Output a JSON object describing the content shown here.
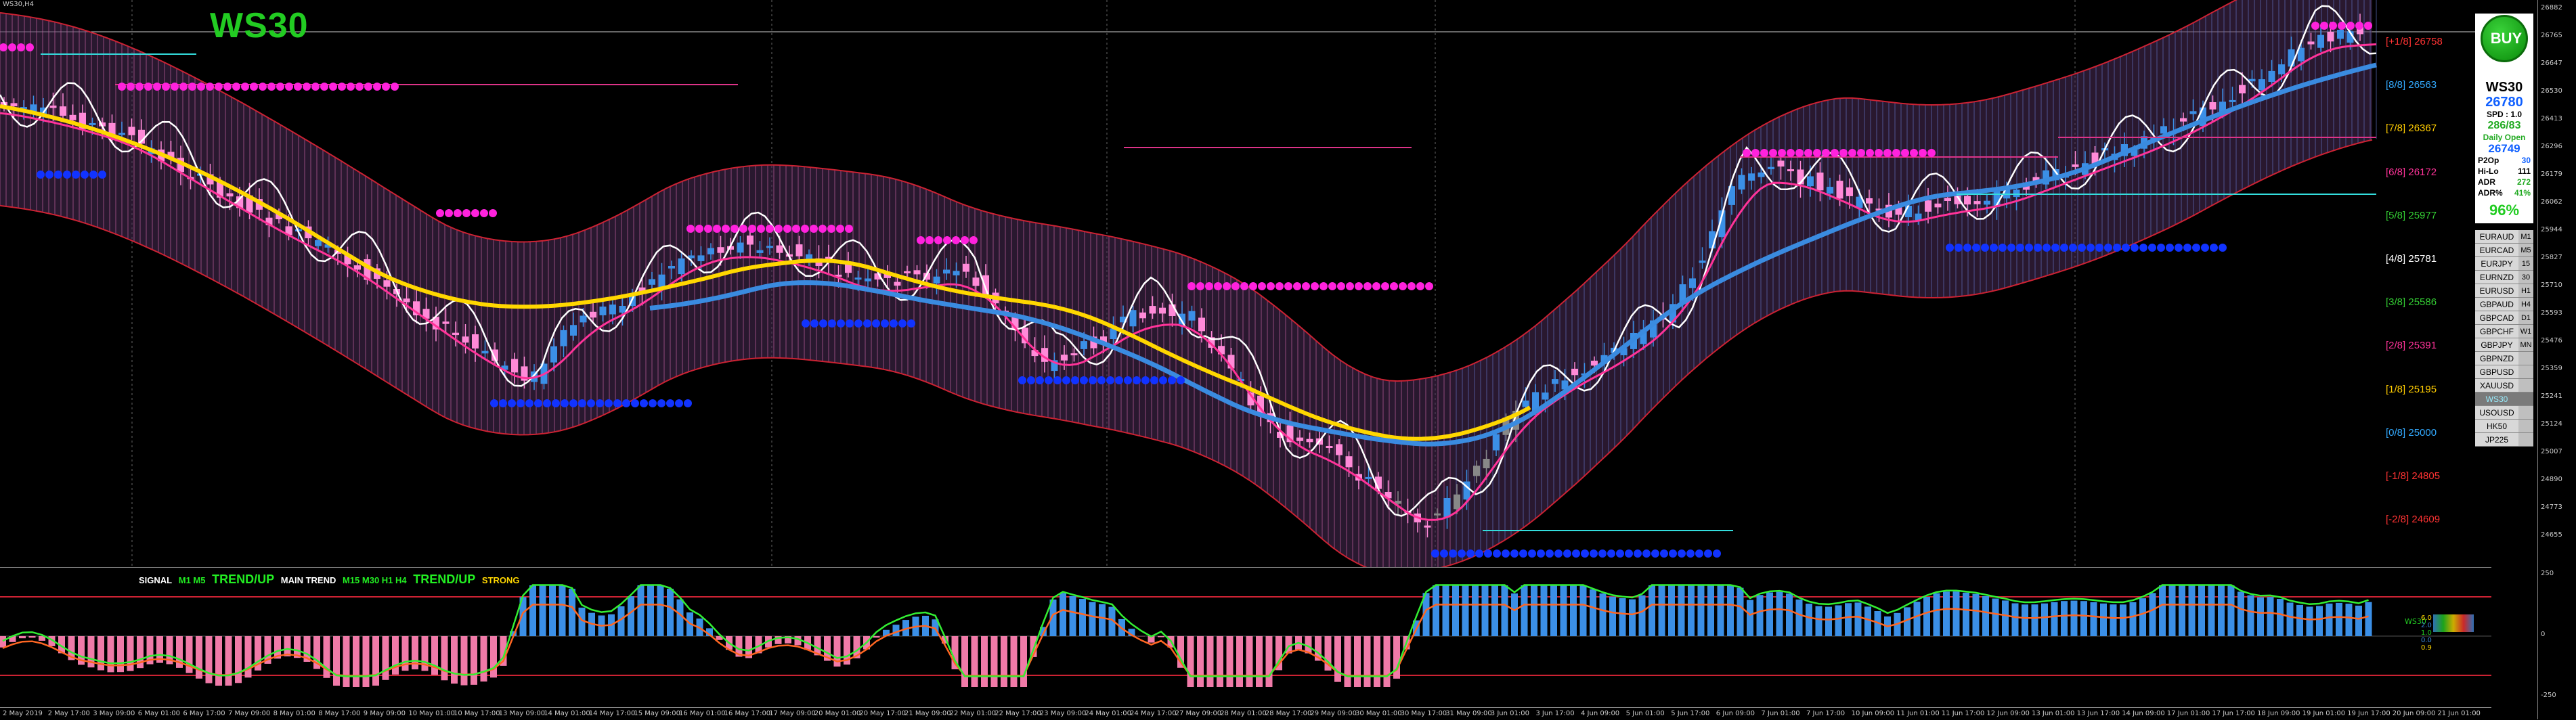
{
  "window": {
    "title": "WS30,H4"
  },
  "symbol": {
    "title": "WS30"
  },
  "murrey_levels": [
    {
      "label": "[+1/8] 26758",
      "color": "#ff3333"
    },
    {
      "label": "[8/8] 26563",
      "color": "#33aaff"
    },
    {
      "label": "[7/8] 26367",
      "color": "#ffcc00"
    },
    {
      "label": "[6/8] 26172",
      "color": "#ff3399"
    },
    {
      "label": "[5/8] 25977",
      "color": "#33cc33"
    },
    {
      "label": "[4/8] 25781",
      "color": "#ffffff"
    },
    {
      "label": "[3/8] 25586",
      "color": "#33cc33"
    },
    {
      "label": "[2/8] 25391",
      "color": "#ff3399"
    },
    {
      "label": "[1/8] 25195",
      "color": "#ffcc00"
    },
    {
      "label": "[0/8] 25000",
      "color": "#33aaff"
    },
    {
      "label": "[-1/8] 24805",
      "color": "#ff3333"
    },
    {
      "label": "[-2/8] 24609",
      "color": "#ff3333"
    }
  ],
  "signal_panel": {
    "buy_label": "BUY",
    "symbol": "WS30",
    "price": "26780",
    "spread": "SPD : 1.0",
    "range": "286/83",
    "daily_open_label": "Daily Open",
    "daily_open": "26749",
    "rows": [
      {
        "k": "P2Op",
        "v": "30"
      },
      {
        "k": "Hi-Lo",
        "v": "111"
      },
      {
        "k": "ADR",
        "v": "272"
      },
      {
        "k": "ADR%",
        "v": "41%"
      }
    ],
    "strength": "96%"
  },
  "pairs": [
    {
      "name": "EURAUD",
      "tf": "M1"
    },
    {
      "name": "EURCAD",
      "tf": "M5"
    },
    {
      "name": "EURJPY",
      "tf": "15"
    },
    {
      "name": "EURNZD",
      "tf": "30"
    },
    {
      "name": "EURUSD",
      "tf": "H1"
    },
    {
      "name": "GBPAUD",
      "tf": "H4"
    },
    {
      "name": "GBPCAD",
      "tf": "D1"
    },
    {
      "name": "GBPCHF",
      "tf": "W1"
    },
    {
      "name": "GBPJPY",
      "tf": "MN"
    },
    {
      "name": "GBPNZD",
      "tf": ""
    },
    {
      "name": "GBPUSD",
      "tf": ""
    },
    {
      "name": "XAUUSD",
      "tf": ""
    },
    {
      "name": "WS30",
      "tf": ""
    },
    {
      "name": "USOUSD",
      "tf": ""
    },
    {
      "name": "HK50",
      "tf": ""
    },
    {
      "name": "JP225",
      "tf": ""
    }
  ],
  "osc_header": {
    "signal": "SIGNAL",
    "signal_tf": "M1 M5",
    "signal_trend": "TREND/UP",
    "main_trend": "MAIN TREND",
    "main_tf": "M15 M30 H1 H4",
    "main_trend_val": "TREND/UP",
    "strength": "STRONG"
  },
  "osc_legend": {
    "label": "WS30",
    "levels": [
      "6.0",
      "2.0",
      "1.0",
      "0.0",
      "0.9"
    ]
  },
  "time_labels": [
    "2 May 2019",
    "2 May 17:00",
    "3 May 09:00",
    "6 May 01:00",
    "6 May 17:00",
    "7 May 09:00",
    "8 May 01:00",
    "8 May 17:00",
    "9 May 09:00",
    "10 May 01:00",
    "10 May 17:00",
    "13 May 09:00",
    "14 May 01:00",
    "14 May 17:00",
    "15 May 09:00",
    "16 May 01:00",
    "16 May 17:00",
    "17 May 09:00",
    "20 May 01:00",
    "20 May 17:00",
    "21 May 09:00",
    "22 May 01:00",
    "22 May 17:00",
    "23 May 09:00",
    "24 May 01:00",
    "24 May 17:00",
    "27 May 09:00",
    "28 May 01:00",
    "28 May 17:00",
    "29 May 09:00",
    "30 May 01:00",
    "30 May 17:00",
    "31 May 09:00",
    "3 Jun 01:00",
    "3 Jun 17:00",
    "4 Jun 09:00",
    "5 Jun 01:00",
    "5 Jun 17:00",
    "6 Jun 09:00",
    "7 Jun 01:00",
    "7 Jun 17:00",
    "10 Jun 09:00",
    "11 Jun 01:00",
    "11 Jun 17:00",
    "12 Jun 09:00",
    "13 Jun 01:00",
    "13 Jun 17:00",
    "14 Jun 09:00",
    "17 Jun 01:00",
    "17 Jun 17:00",
    "18 Jun 09:00",
    "19 Jun 01:00",
    "19 Jun 17:00",
    "20 Jun 09:00",
    "21 Jun 01:00"
  ],
  "price_scale": [
    "26882",
    "26765",
    "26647",
    "26530",
    "26413",
    "26296",
    "26179",
    "26062",
    "25944",
    "25827",
    "25710",
    "25593",
    "25476",
    "25359",
    "25241",
    "25124",
    "25007",
    "24890",
    "24773",
    "24655"
  ],
  "osc_scale": [
    "250",
    "0",
    "-250"
  ],
  "colors": {
    "up": "#3b8fe6",
    "down": "#ff8ad8",
    "band": "#cc2233",
    "ma_fast": "#ff3399",
    "ma_slow": "#ffd700",
    "ma_trend": "#3a8be0"
  }
}
